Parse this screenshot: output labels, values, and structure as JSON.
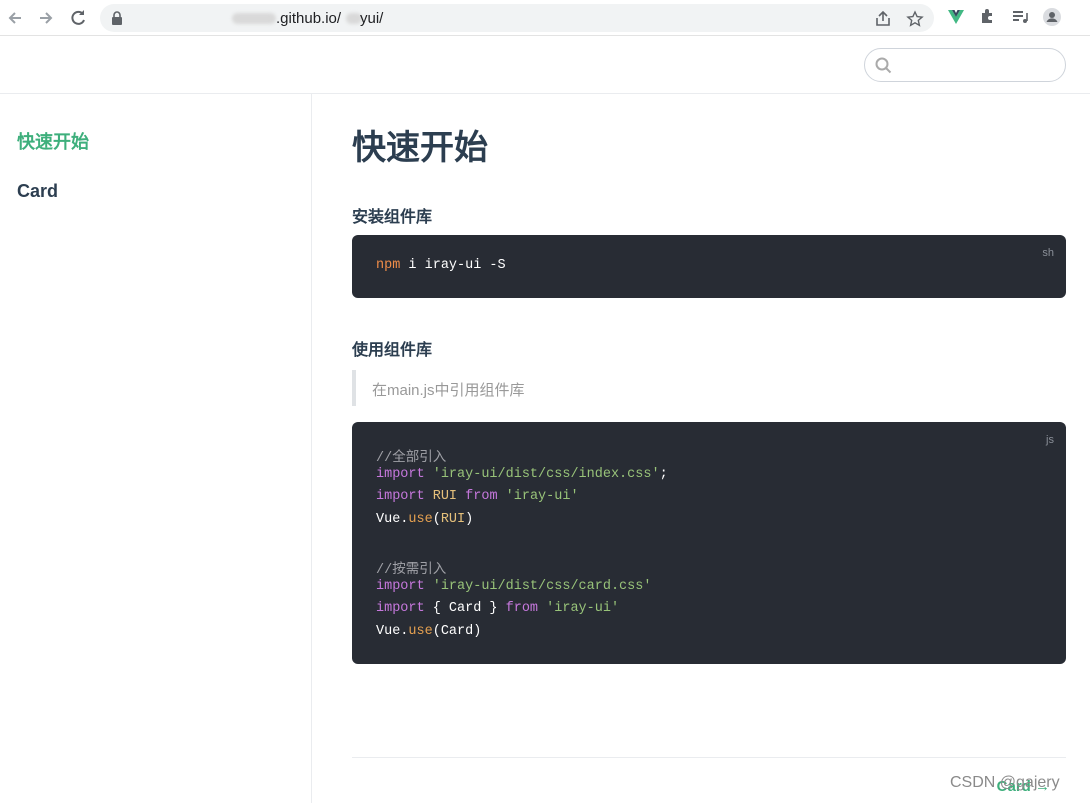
{
  "browser": {
    "url_visible": ".github.io/",
    "url_suffix": "yui/"
  },
  "header": {
    "search_placeholder": ""
  },
  "sidebar": {
    "items": [
      {
        "label": "快速开始",
        "active": true
      },
      {
        "label": "Card",
        "active": false
      }
    ]
  },
  "main": {
    "title": "快速开始",
    "section_install": "安装组件库",
    "install_code": {
      "lang": "sh",
      "npm": "npm",
      "rest": " i iray-ui -S"
    },
    "section_use": "使用组件库",
    "quote": "在main.js中引用组件库",
    "use_code": {
      "lang": "js",
      "comment_all": "//全部引入",
      "comment_on_demand": "//按需引入"
    },
    "next_link": "Card →"
  },
  "watermark": "CSDN @gajery",
  "colors": {
    "accent": "#3eaf7c",
    "code_bg": "#282c34",
    "text": "#2c3e50"
  }
}
